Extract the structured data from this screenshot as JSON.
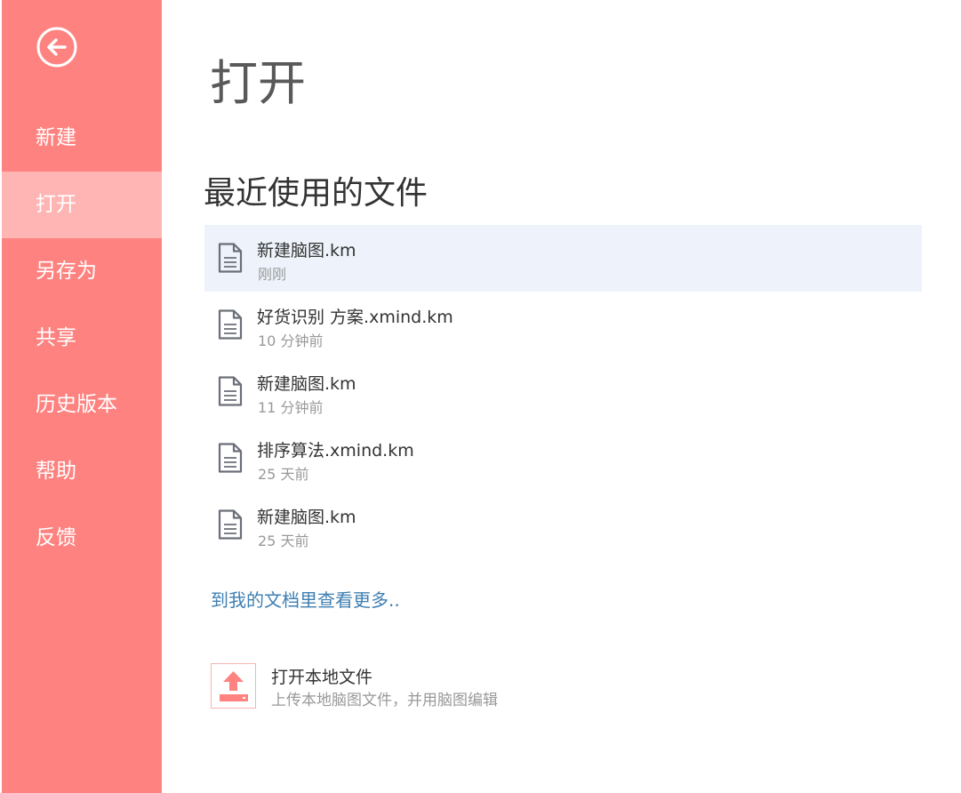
{
  "sidebar": {
    "back_icon": "back-arrow-circle-icon",
    "items": [
      {
        "label": "新建"
      },
      {
        "label": "打开"
      },
      {
        "label": "另存为"
      },
      {
        "label": "共享"
      },
      {
        "label": "历史版本"
      },
      {
        "label": "帮助"
      },
      {
        "label": "反馈"
      }
    ],
    "active": "打开"
  },
  "main": {
    "title": "打开",
    "recent_title": "最近使用的文件",
    "files": [
      {
        "name": "新建脑图.km",
        "time": "刚刚"
      },
      {
        "name": "好货识别 方案.xmind.km",
        "time": "10 分钟前"
      },
      {
        "name": "新建脑图.km",
        "time": "11 分钟前"
      },
      {
        "name": "排序算法.xmind.km",
        "time": "25 天前"
      },
      {
        "name": "新建脑图.km",
        "time": "25 天前"
      }
    ],
    "more_link": "到我的文档里查看更多..",
    "upload": {
      "title": "打开本地文件",
      "desc": "上传本地脑图文件，并用脑图编辑",
      "icon": "upload-icon"
    }
  },
  "colors": {
    "sidebar_bg": "#fe8380",
    "sidebar_active": "#feb5b3",
    "file_active_bg": "#eef3fb",
    "link": "#3f7fb2"
  }
}
